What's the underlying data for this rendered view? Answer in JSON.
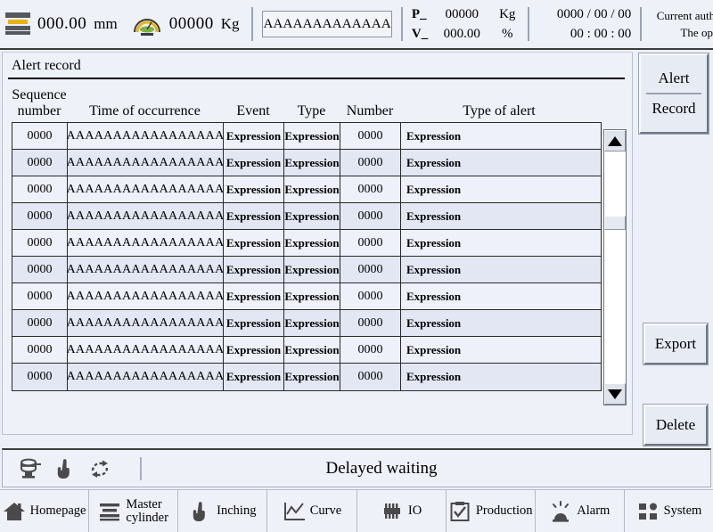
{
  "header": {
    "press_icon": "press-mold-icon",
    "position_value": "000.00",
    "position_unit": "mm",
    "gauge_icon": "gauge-icon",
    "weight_value": "00000",
    "weight_unit": "Kg",
    "name_field_value": "AAAAAAAAAAAAA",
    "pressure_label": "P_",
    "pressure_value": "00000",
    "pressure_unit": "Kg",
    "velocity_label": "V_",
    "velocity_value": "000.00",
    "velocity_unit": "%",
    "date": "0000 / 00 / 00",
    "time": "00 : 00 : 00",
    "authority_label": "Current authority:",
    "authority_value": "The operator"
  },
  "panel": {
    "title": "Alert record",
    "columns": [
      "Sequence\nnumber",
      "Time of occurrence",
      "Event",
      "Type",
      "Number",
      "Type of alert"
    ],
    "rows": [
      {
        "seq": "0000",
        "time": "AAAAAAAAAAAAAAAAA",
        "event": "Expression",
        "type": "Expression",
        "number": "0000",
        "alert": "Expression"
      },
      {
        "seq": "0000",
        "time": "AAAAAAAAAAAAAAAAA",
        "event": "Expression",
        "type": "Expression",
        "number": "0000",
        "alert": "Expression"
      },
      {
        "seq": "0000",
        "time": "AAAAAAAAAAAAAAAAA",
        "event": "Expression",
        "type": "Expression",
        "number": "0000",
        "alert": "Expression"
      },
      {
        "seq": "0000",
        "time": "AAAAAAAAAAAAAAAAA",
        "event": "Expression",
        "type": "Expression",
        "number": "0000",
        "alert": "Expression"
      },
      {
        "seq": "0000",
        "time": "AAAAAAAAAAAAAAAAA",
        "event": "Expression",
        "type": "Expression",
        "number": "0000",
        "alert": "Expression"
      },
      {
        "seq": "0000",
        "time": "AAAAAAAAAAAAAAAAA",
        "event": "Expression",
        "type": "Expression",
        "number": "0000",
        "alert": "Expression"
      },
      {
        "seq": "0000",
        "time": "AAAAAAAAAAAAAAAAA",
        "event": "Expression",
        "type": "Expression",
        "number": "0000",
        "alert": "Expression"
      },
      {
        "seq": "0000",
        "time": "AAAAAAAAAAAAAAAAA",
        "event": "Expression",
        "type": "Expression",
        "number": "0000",
        "alert": "Expression"
      },
      {
        "seq": "0000",
        "time": "AAAAAAAAAAAAAAAAA",
        "event": "Expression",
        "type": "Expression",
        "number": "0000",
        "alert": "Expression"
      },
      {
        "seq": "0000",
        "time": "AAAAAAAAAAAAAAAAA",
        "event": "Expression",
        "type": "Expression",
        "number": "0000",
        "alert": "Expression"
      }
    ]
  },
  "side": {
    "alert_label": "Alert",
    "record_label": "Record",
    "export_label": "Export",
    "delete_label": "Delete"
  },
  "statusbar": {
    "icons": [
      "press-icon",
      "hand-icon",
      "cycle-icon"
    ],
    "status_text": "Delayed waiting"
  },
  "nav": [
    {
      "icon": "home-icon",
      "label": "Homepage"
    },
    {
      "icon": "cylinder-icon",
      "label": "Master\ncylinder"
    },
    {
      "icon": "hand-icon",
      "label": "Inching"
    },
    {
      "icon": "curve-icon",
      "label": "Curve"
    },
    {
      "icon": "io-chip-icon",
      "label": "IO"
    },
    {
      "icon": "clipboard-icon",
      "label": "Production"
    },
    {
      "icon": "alarm-siren-icon",
      "label": "Alarm"
    },
    {
      "icon": "grid-icon",
      "label": "System"
    }
  ],
  "colors": {
    "panel_bg": "#eef1f8",
    "row_odd": "#eef1f9",
    "row_even": "#e2e7f3",
    "accent_yellow": "#e8b317",
    "border_dark": "#2a2a2a"
  }
}
